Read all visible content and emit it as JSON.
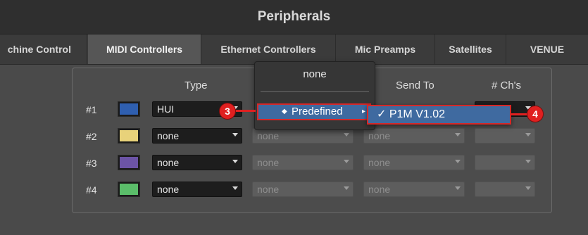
{
  "window": {
    "title": "Peripherals"
  },
  "tabs": [
    {
      "label": "chine Control"
    },
    {
      "label": "MIDI Controllers"
    },
    {
      "label": "Ethernet Controllers"
    },
    {
      "label": "Mic Preamps"
    },
    {
      "label": "Satellites"
    },
    {
      "label": "VENUE"
    }
  ],
  "active_tab": "MIDI Controllers",
  "columns": {
    "type": "Type",
    "send_to": "Send To",
    "channels": "# Ch's"
  },
  "rows": [
    {
      "number": "#1",
      "color": "#2f5fb0",
      "type": "HUI"
    },
    {
      "number": "#2",
      "color": "#e8d27a",
      "type": "none",
      "receive": "none",
      "send": "none"
    },
    {
      "number": "#3",
      "color": "#6c54a6",
      "type": "none",
      "receive": "none",
      "send": "none"
    },
    {
      "number": "#4",
      "color": "#5bbe6a",
      "type": "none",
      "receive": "none",
      "send": "none"
    }
  ],
  "dropdown_menu": {
    "none_option": "none",
    "predefined_label": "Predefined",
    "submenu_item": "✓  P1M V1.02"
  },
  "callouts": {
    "step3": "3",
    "step4": "4"
  },
  "colors": {
    "highlight": "#3f6aa0",
    "callout": "#e02020"
  }
}
